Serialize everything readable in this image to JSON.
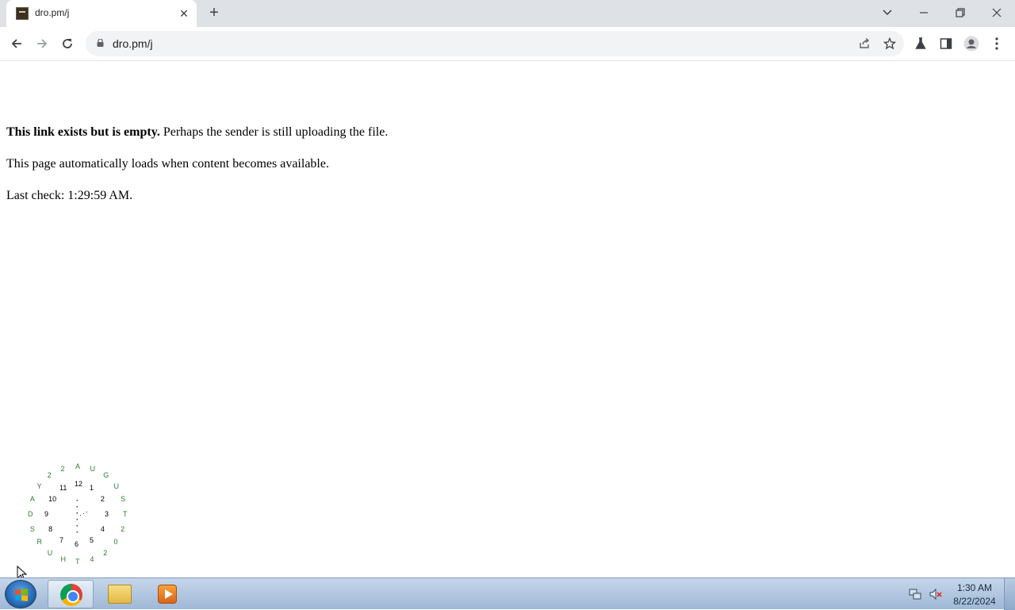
{
  "browser": {
    "tab_title": "dro.pm/j",
    "url": "dro.pm/j"
  },
  "content": {
    "message_bold": "This link exists but is empty.",
    "message_rest": " Perhaps the sender is still uploading the file.",
    "auto_load_text": "This page automatically loads when content becomes available.",
    "last_check_label": "Last check: ",
    "last_check_time": "1:29:59 AM."
  },
  "clock_widget": {
    "numbers": [
      "12",
      "1",
      "2",
      "3",
      "4",
      "5",
      "6",
      "7",
      "8",
      "9",
      "10",
      "11"
    ],
    "ring_letters": [
      "A",
      "U",
      "G",
      "U",
      "S",
      "T",
      "2",
      "0",
      "2",
      "4",
      "T",
      "H",
      "U",
      "R",
      "S",
      "D",
      "A",
      "Y",
      "2",
      "2"
    ]
  },
  "taskbar": {
    "time": "1:30 AM",
    "date": "8/22/2024"
  },
  "icons": {
    "back": "back-arrow-icon",
    "forward": "forward-arrow-icon",
    "reload": "reload-icon",
    "lock": "lock-icon",
    "share": "share-icon",
    "bookmark": "star-icon",
    "labs": "flask-icon",
    "sidepanel": "side-panel-icon",
    "profile": "profile-icon",
    "menu": "kebab-menu-icon"
  }
}
